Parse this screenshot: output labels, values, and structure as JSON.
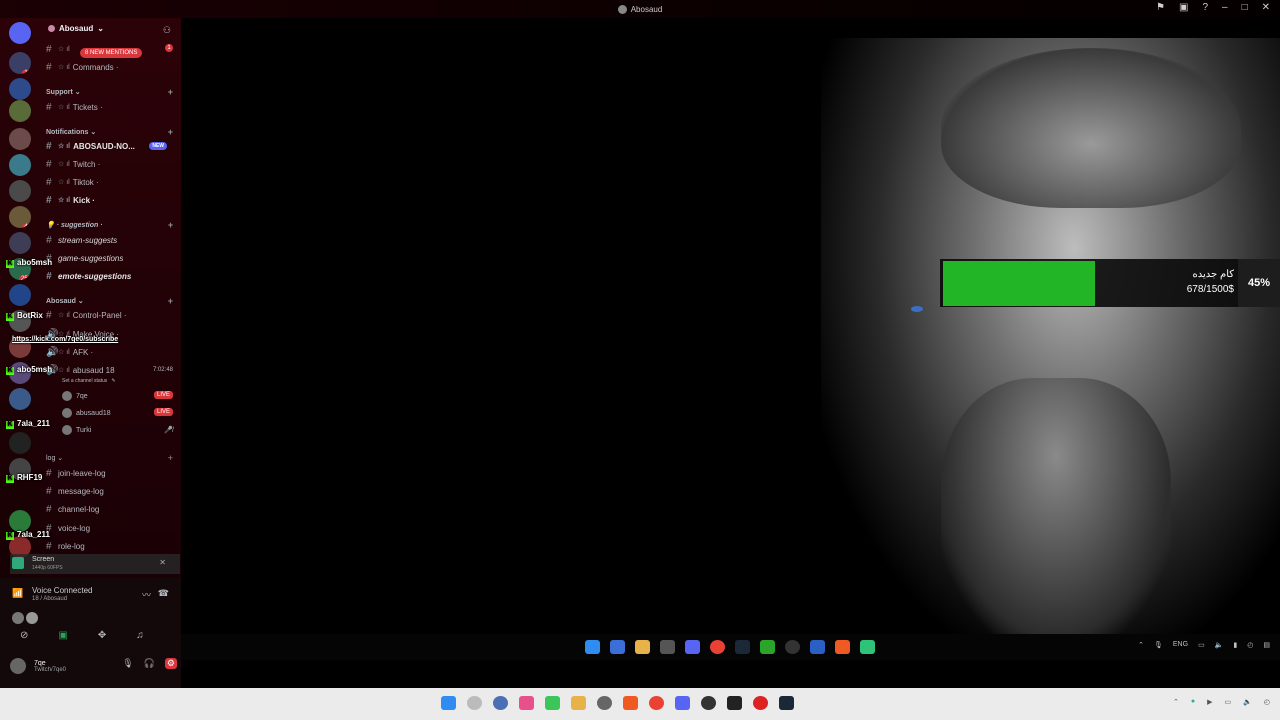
{
  "window": {
    "title": "Abosaud"
  },
  "server": {
    "name": "Abosaud",
    "new_mentions": "8 NEW MENTIONS",
    "mention_count": "1"
  },
  "rail_badges": [
    "12",
    "8",
    "44",
    "258",
    "4"
  ],
  "channels_top": [
    {
      "prefix": "☆ ıl",
      "name": "Commands",
      "suffix": "·"
    }
  ],
  "support": {
    "label": "Support",
    "channels": [
      {
        "prefix": "☆ ıl",
        "name": "Tickets",
        "suffix": "·"
      }
    ]
  },
  "notifications": {
    "label": "Notifications",
    "new_pill": "NEW",
    "channels": [
      {
        "prefix": "☆ ıl",
        "name": "ABOSAUD-NO...",
        "suffix": ""
      },
      {
        "prefix": "☆ ıl",
        "name": "Twitch",
        "suffix": "·"
      },
      {
        "prefix": "☆ ıl",
        "name": "Tiktok",
        "suffix": "·"
      },
      {
        "prefix": "☆ ıl",
        "name": "Kick",
        "suffix": "·"
      }
    ]
  },
  "suggestion": {
    "label": "· suggestion ·",
    "channels": [
      "stream-suggests",
      "game-suggestions",
      "emote-suggestions"
    ]
  },
  "abosaud_cat": {
    "label": "Abosaud",
    "channels": [
      {
        "prefix": "☆ ıl",
        "name": "Control-Panel",
        "suffix": "·"
      },
      {
        "prefix": "☆ ıl",
        "name": "Make Voice",
        "suffix": "·"
      },
      {
        "prefix": "☆ ıl",
        "name": "AFK",
        "suffix": "·"
      },
      {
        "prefix": "☆ ıl",
        "name": "abusaud 18",
        "suffix": ""
      }
    ],
    "voice_timer": "7:02:48",
    "channel_status": "Set a channel status",
    "voice_users": [
      {
        "name": "7qe",
        "live": "LIVE"
      },
      {
        "name": "abusaud18",
        "live": "LIVE"
      },
      {
        "name": "Turki",
        "live": ""
      }
    ]
  },
  "log": {
    "label": "log",
    "channels": [
      "join-leave-log",
      "message-log",
      "channel-log",
      "voice-log",
      "role-log"
    ]
  },
  "overlay_chat": [
    {
      "user": "abo5msh",
      "text": ""
    },
    {
      "user": "BotRix",
      "text": ""
    },
    {
      "user": "",
      "text": "https://kick.com/7qe0/subscribe"
    },
    {
      "user": "abo5msh",
      "text": ""
    },
    {
      "user": "7ala_211",
      "text": ""
    },
    {
      "user": "RHF19",
      "text": ""
    },
    {
      "user": "7ala_211",
      "text": ""
    }
  ],
  "overlay_emojis": "😂😂😂",
  "screen_share": {
    "label": "Screen",
    "quality": "1440p 60FPS"
  },
  "voice_panel": {
    "status": "Voice Connected",
    "channel": "18 / Abosaud"
  },
  "user_panel": {
    "name": "7qe",
    "status": "Twitch/7qe0"
  },
  "goal": {
    "title": "كام جديده",
    "amount": "678/1500$",
    "percent_label": "45%",
    "progress": 0.45,
    "bar_color": "#22b526"
  },
  "inner_taskbar": {
    "icons": [
      "windows-icon",
      "file-explorer-icon",
      "folder-icon",
      "settings-icon",
      "discord-icon",
      "chrome-icon",
      "steam-icon",
      "xbox-icon",
      "obs-icon",
      "app-icon",
      "brave-icon",
      "kick-icon"
    ],
    "tray": [
      "ENG"
    ]
  },
  "outer_taskbar": {
    "icons": [
      "windows-icon",
      "search-icon",
      "settings-icon",
      "app-icon",
      "app-icon",
      "folder-icon",
      "settings-icon",
      "brave-icon",
      "chrome-icon",
      "discord-icon",
      "obs-icon",
      "terminal-icon",
      "app-icon",
      "steam-icon"
    ]
  }
}
